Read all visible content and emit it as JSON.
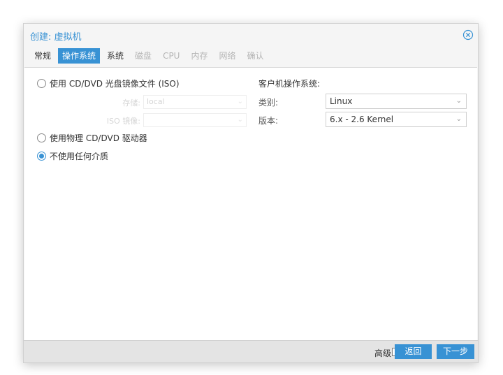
{
  "dialog": {
    "title": "创建: 虚拟机",
    "close_icon": "close-circle-icon"
  },
  "tabs": [
    {
      "label": "常规",
      "state": "normal"
    },
    {
      "label": "操作系统",
      "state": "active"
    },
    {
      "label": "系统",
      "state": "normal"
    },
    {
      "label": "磁盘",
      "state": "disabled"
    },
    {
      "label": "CPU",
      "state": "disabled"
    },
    {
      "label": "内存",
      "state": "disabled"
    },
    {
      "label": "网络",
      "state": "disabled"
    },
    {
      "label": "确认",
      "state": "disabled"
    }
  ],
  "media": {
    "iso_option": "使用 CD/DVD 光盘镜像文件 (ISO)",
    "storage_label": "存储:",
    "storage_value": "local",
    "iso_image_label": "ISO 镜像:",
    "iso_image_value": "",
    "physical_option": "使用物理 CD/DVD 驱动器",
    "none_option": "不使用任何介质",
    "selected": "none"
  },
  "guest_os": {
    "title": "客户机操作系统:",
    "type_label": "类别:",
    "type_value": "Linux",
    "version_label": "版本:",
    "version_value": "6.x - 2.6 Kernel"
  },
  "footer": {
    "advanced_label": "高级",
    "advanced_checked": false,
    "back_label": "返回",
    "next_label": "下一步"
  },
  "colors": {
    "accent": "#3892d4",
    "disabled_text": "#b5b5b5",
    "footer_bg": "#e4e4e4"
  }
}
